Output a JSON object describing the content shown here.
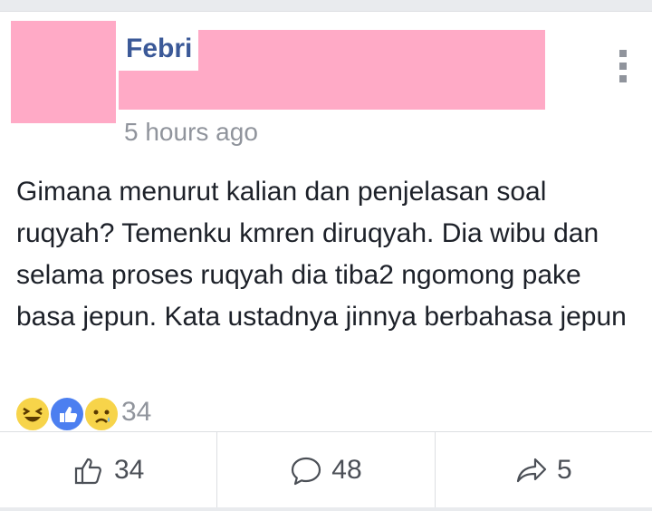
{
  "post": {
    "author_name": "Febri",
    "timestamp": "5 hours ago",
    "text": "Gimana menurut kalian dan penjelasan soal ruqyah? Temenku kmren diruqyah. Dia wibu dan selama proses ruqyah dia tiba2 ngomong pake basa jepun. Kata ustadnya jinnya berbahasa jepun",
    "redaction_color": "#ffaac6"
  },
  "reactions": {
    "icons": [
      "haha-icon",
      "like-icon",
      "sad-icon"
    ],
    "count": "34"
  },
  "actions": {
    "like": {
      "icon": "thumbs-up-icon",
      "count": "34"
    },
    "comment": {
      "icon": "comment-bubble-icon",
      "count": "48"
    },
    "share": {
      "icon": "share-arrow-icon",
      "count": "5"
    }
  },
  "colors": {
    "author_blue": "#3b5998",
    "secondary_text": "#90949c",
    "body_text": "#1d2129",
    "like_blue": "#4c7ff0",
    "emoji_yellow": "#f7d44a"
  }
}
